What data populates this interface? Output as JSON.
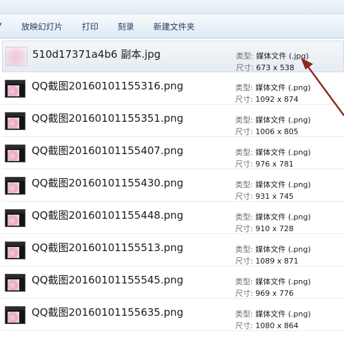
{
  "toolbar": {
    "items": [
      {
        "label": "放映幻灯片"
      },
      {
        "label": "打印"
      },
      {
        "label": "刻录"
      },
      {
        "label": "新建文件夹"
      }
    ]
  },
  "labels": {
    "type_key": "类型: ",
    "size_key": "尺寸: "
  },
  "files": [
    {
      "name": "510d17371a4b6 副本.jpg",
      "type": "媒体文件 (.jpg)",
      "size": "673 x 538",
      "selected": true
    },
    {
      "name": "QQ截图20160101155316.png",
      "type": "媒体文件 (.png)",
      "size": "1092 x 874"
    },
    {
      "name": "QQ截图20160101155351.png",
      "type": "媒体文件 (.png)",
      "size": "1006 x 805"
    },
    {
      "name": "QQ截图20160101155407.png",
      "type": "媒体文件 (.png)",
      "size": "976 x 781"
    },
    {
      "name": "QQ截图20160101155430.png",
      "type": "媒体文件 (.png)",
      "size": "931 x 745"
    },
    {
      "name": "QQ截图20160101155448.png",
      "type": "媒体文件 (.png)",
      "size": "910 x 728"
    },
    {
      "name": "QQ截图20160101155513.png",
      "type": "媒体文件 (.png)",
      "size": "1089 x 871"
    },
    {
      "name": "QQ截图20160101155545.png",
      "type": "媒体文件 (.png)",
      "size": "969 x 776"
    },
    {
      "name": "QQ截图20160101155635.png",
      "type": "媒体文件 (.png)",
      "size": "1080 x 864"
    }
  ],
  "colors": {
    "annotation_arrow": "#8b2a22",
    "toolbar_text": "#1e395b"
  }
}
